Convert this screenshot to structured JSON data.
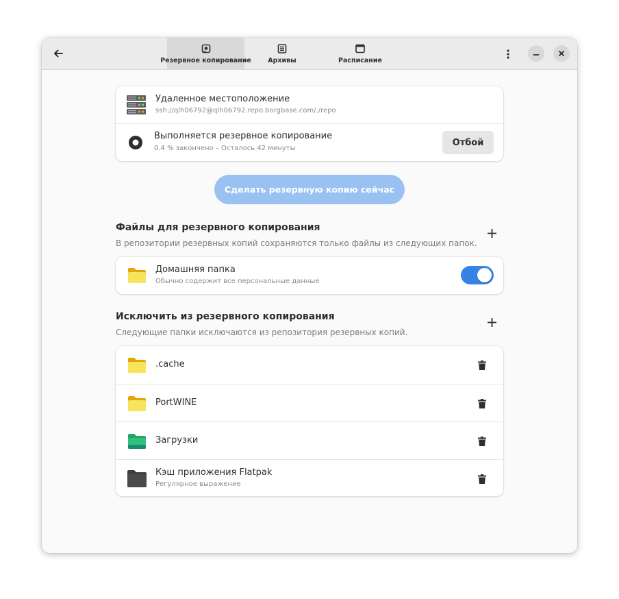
{
  "header": {
    "tabs": [
      {
        "label": "Резервное копирование",
        "icon": "backup-icon",
        "active": true
      },
      {
        "label": "Архивы",
        "icon": "archive-icon",
        "active": false
      },
      {
        "label": "Расписание",
        "icon": "calendar-icon",
        "active": false
      }
    ]
  },
  "location": {
    "title": "Удаленное местоположение",
    "path": "ssh://qlh06792@qlh06792.repo.borgbase.com/./repo",
    "icon": "server-icon"
  },
  "status": {
    "title": "Выполняется резервное копирование",
    "progress_text": "0.4 % закончено – Осталось 42 минуты",
    "progress_percent": 0.4,
    "cancel_label": "Отбой"
  },
  "backup_now_label": "Сделать резервную копию сейчас",
  "include": {
    "title": "Файлы для резервного копирования",
    "description": "В репозитории резервных копий сохраняются только файлы из следующих папок.",
    "items": [
      {
        "name": "Домашняя папка",
        "description": "Обычно содержит все персональные данные",
        "enabled": true,
        "icon": "home-folder-icon"
      }
    ]
  },
  "exclude": {
    "title": "Исключить из резервного копирования",
    "description": "Следующие папки исключаются из репозитория резервных копий.",
    "items": [
      {
        "name": ".cache",
        "sub": "",
        "icon": "folder-icon",
        "color": "#f6d32d"
      },
      {
        "name": "PortWINE",
        "sub": "",
        "icon": "folder-icon",
        "color": "#f6d32d"
      },
      {
        "name": "Загрузки",
        "sub": "",
        "icon": "downloads-folder-icon",
        "color": "#26a269"
      },
      {
        "name": "Кэш приложения Flatpak",
        "sub": "Регулярное выражение",
        "icon": "flatpak-folder-icon",
        "color": "#3d3d3d"
      }
    ]
  },
  "colors": {
    "accent": "#3584e4",
    "suggested_button_disabled": "#99c1f1"
  }
}
